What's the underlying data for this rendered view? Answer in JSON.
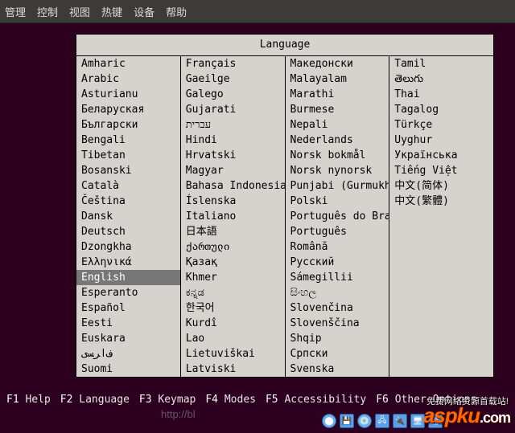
{
  "menubar": [
    "管理",
    "控制",
    "视图",
    "热键",
    "设备",
    "帮助"
  ],
  "title": "Language",
  "columns": [
    [
      "Amharic",
      "Arabic",
      "Asturianu",
      "Беларуская",
      "Български",
      "Bengali",
      "Tibetan",
      "Bosanski",
      "Català",
      "Čeština",
      "Dansk",
      "Deutsch",
      "Dzongkha",
      "Ελληνικά",
      "English",
      "Esperanto",
      "Español",
      "Eesti",
      "Euskara",
      "ﻑﺍﺮﺴﻯ",
      "Suomi"
    ],
    [
      "Français",
      "Gaeilge",
      "Galego",
      "Gujarati",
      "עברית",
      "Hindi",
      "Hrvatski",
      "Magyar",
      "Bahasa Indonesia",
      "Íslenska",
      "Italiano",
      "日本語",
      "ქართული",
      "Қазақ",
      "Khmer",
      "ಕನ್ನಡ",
      "한국어",
      "Kurdî",
      "Lao",
      "Lietuviškai",
      "Latviski"
    ],
    [
      "Македонски",
      "Malayalam",
      "Marathi",
      "Burmese",
      "Nepali",
      "Nederlands",
      "Norsk bokmål",
      "Norsk nynorsk",
      "Punjabi (Gurmukhi)",
      "Polski",
      "Português do Brasil",
      "Português",
      "Română",
      "Русский",
      "Sámegillii",
      "සිංහල",
      "Slovenčina",
      "Slovenščina",
      "Shqip",
      "Српски",
      "Svenska"
    ],
    [
      "Tamil",
      "తెలుగు",
      "Thai",
      "Tagalog",
      "Türkçe",
      "Uyghur",
      "Українська",
      "Tiếng Việt",
      "中文(简体)",
      "中文(繁體)"
    ]
  ],
  "selected": "English",
  "fkeys": [
    {
      "key": "F1",
      "label": "Help"
    },
    {
      "key": "F2",
      "label": "Language"
    },
    {
      "key": "F3",
      "label": "Keymap"
    },
    {
      "key": "F4",
      "label": "Modes"
    },
    {
      "key": "F5",
      "label": "Accessibility"
    },
    {
      "key": "F6",
      "label": "Other Options"
    }
  ],
  "url_ghost": "http://bl",
  "watermark": {
    "brand": "aspku",
    "tld": ".com",
    "sub": "免费网络资源首载站!"
  }
}
